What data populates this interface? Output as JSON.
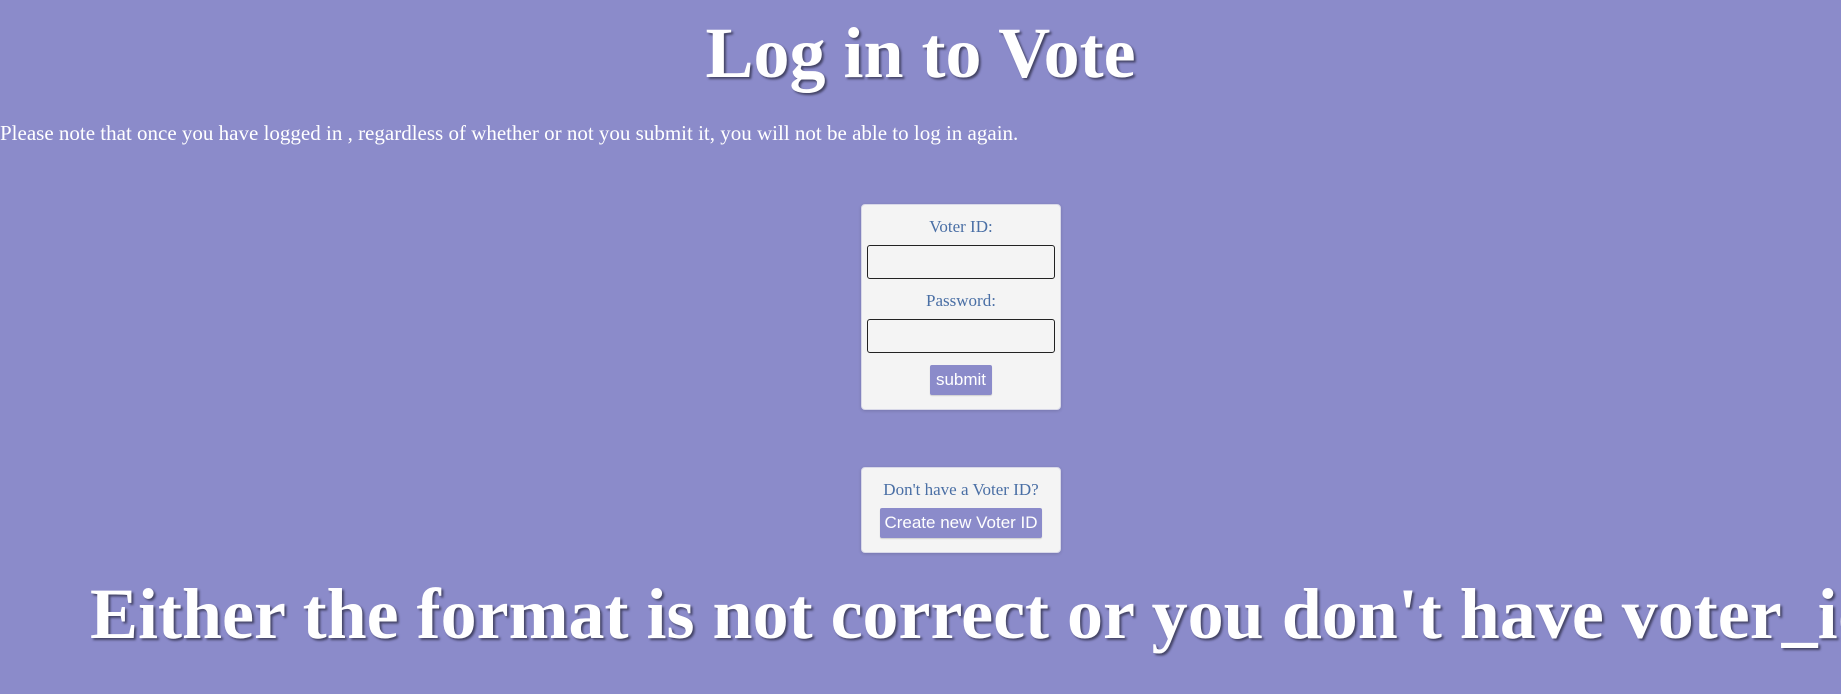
{
  "page": {
    "title": "Log in to Vote",
    "note": "Please note that once you have logged in , regardless of whether or not you submit it, you will not be able to log in again.",
    "error_message": "Either the format is not correct or you don't have voter_id"
  },
  "login_form": {
    "voter_id_label": "Voter ID:",
    "voter_id_value": "",
    "password_label": "Password:",
    "password_value": "",
    "submit_label": "submit"
  },
  "signup": {
    "prompt": "Don't have a Voter ID?",
    "button_label": "Create new Voter ID"
  },
  "colors": {
    "background": "#8b8bca",
    "card": "#f4f4f4",
    "label_text": "#4a6fa5",
    "button": "#8b8bca"
  }
}
